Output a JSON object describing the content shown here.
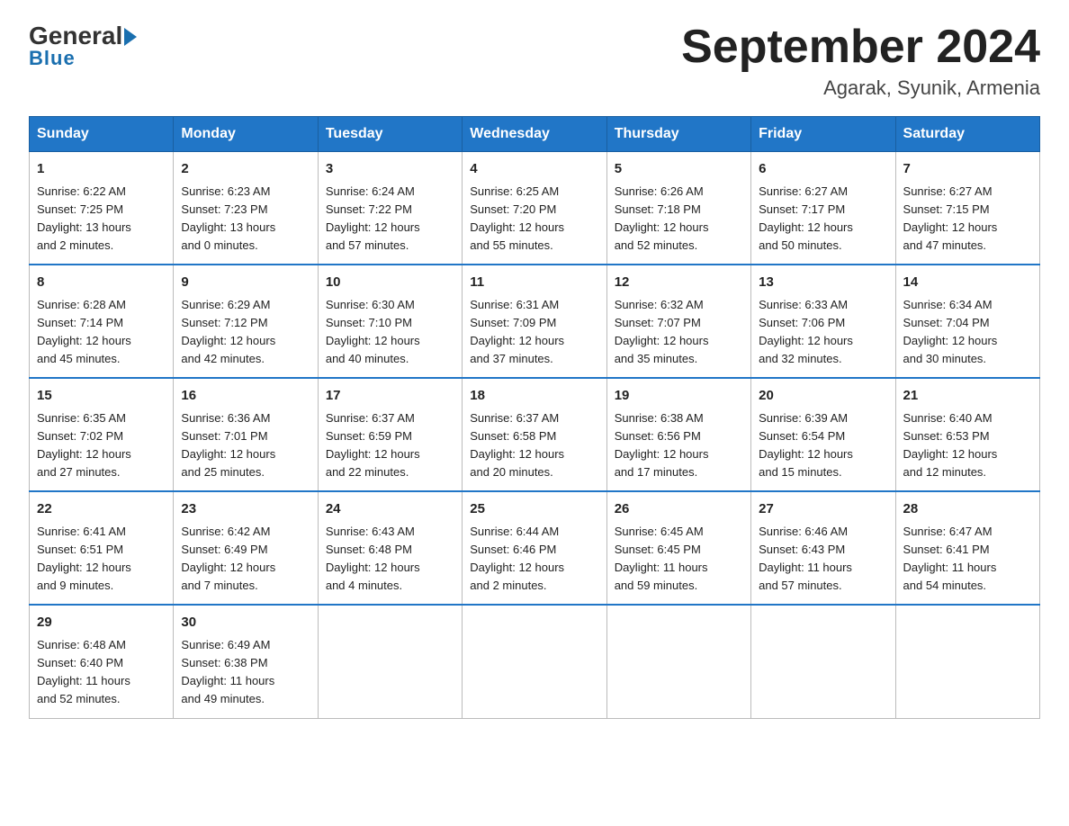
{
  "logo": {
    "general": "General",
    "blue": "Blue",
    "sub": "Blue"
  },
  "header": {
    "title": "September 2024",
    "location": "Agarak, Syunik, Armenia"
  },
  "days_header": [
    "Sunday",
    "Monday",
    "Tuesday",
    "Wednesday",
    "Thursday",
    "Friday",
    "Saturday"
  ],
  "weeks": [
    [
      {
        "day": "1",
        "sunrise": "6:22 AM",
        "sunset": "7:25 PM",
        "daylight": "13 hours and 2 minutes."
      },
      {
        "day": "2",
        "sunrise": "6:23 AM",
        "sunset": "7:23 PM",
        "daylight": "13 hours and 0 minutes."
      },
      {
        "day": "3",
        "sunrise": "6:24 AM",
        "sunset": "7:22 PM",
        "daylight": "12 hours and 57 minutes."
      },
      {
        "day": "4",
        "sunrise": "6:25 AM",
        "sunset": "7:20 PM",
        "daylight": "12 hours and 55 minutes."
      },
      {
        "day": "5",
        "sunrise": "6:26 AM",
        "sunset": "7:18 PM",
        "daylight": "12 hours and 52 minutes."
      },
      {
        "day": "6",
        "sunrise": "6:27 AM",
        "sunset": "7:17 PM",
        "daylight": "12 hours and 50 minutes."
      },
      {
        "day": "7",
        "sunrise": "6:27 AM",
        "sunset": "7:15 PM",
        "daylight": "12 hours and 47 minutes."
      }
    ],
    [
      {
        "day": "8",
        "sunrise": "6:28 AM",
        "sunset": "7:14 PM",
        "daylight": "12 hours and 45 minutes."
      },
      {
        "day": "9",
        "sunrise": "6:29 AM",
        "sunset": "7:12 PM",
        "daylight": "12 hours and 42 minutes."
      },
      {
        "day": "10",
        "sunrise": "6:30 AM",
        "sunset": "7:10 PM",
        "daylight": "12 hours and 40 minutes."
      },
      {
        "day": "11",
        "sunrise": "6:31 AM",
        "sunset": "7:09 PM",
        "daylight": "12 hours and 37 minutes."
      },
      {
        "day": "12",
        "sunrise": "6:32 AM",
        "sunset": "7:07 PM",
        "daylight": "12 hours and 35 minutes."
      },
      {
        "day": "13",
        "sunrise": "6:33 AM",
        "sunset": "7:06 PM",
        "daylight": "12 hours and 32 minutes."
      },
      {
        "day": "14",
        "sunrise": "6:34 AM",
        "sunset": "7:04 PM",
        "daylight": "12 hours and 30 minutes."
      }
    ],
    [
      {
        "day": "15",
        "sunrise": "6:35 AM",
        "sunset": "7:02 PM",
        "daylight": "12 hours and 27 minutes."
      },
      {
        "day": "16",
        "sunrise": "6:36 AM",
        "sunset": "7:01 PM",
        "daylight": "12 hours and 25 minutes."
      },
      {
        "day": "17",
        "sunrise": "6:37 AM",
        "sunset": "6:59 PM",
        "daylight": "12 hours and 22 minutes."
      },
      {
        "day": "18",
        "sunrise": "6:37 AM",
        "sunset": "6:58 PM",
        "daylight": "12 hours and 20 minutes."
      },
      {
        "day": "19",
        "sunrise": "6:38 AM",
        "sunset": "6:56 PM",
        "daylight": "12 hours and 17 minutes."
      },
      {
        "day": "20",
        "sunrise": "6:39 AM",
        "sunset": "6:54 PM",
        "daylight": "12 hours and 15 minutes."
      },
      {
        "day": "21",
        "sunrise": "6:40 AM",
        "sunset": "6:53 PM",
        "daylight": "12 hours and 12 minutes."
      }
    ],
    [
      {
        "day": "22",
        "sunrise": "6:41 AM",
        "sunset": "6:51 PM",
        "daylight": "12 hours and 9 minutes."
      },
      {
        "day": "23",
        "sunrise": "6:42 AM",
        "sunset": "6:49 PM",
        "daylight": "12 hours and 7 minutes."
      },
      {
        "day": "24",
        "sunrise": "6:43 AM",
        "sunset": "6:48 PM",
        "daylight": "12 hours and 4 minutes."
      },
      {
        "day": "25",
        "sunrise": "6:44 AM",
        "sunset": "6:46 PM",
        "daylight": "12 hours and 2 minutes."
      },
      {
        "day": "26",
        "sunrise": "6:45 AM",
        "sunset": "6:45 PM",
        "daylight": "11 hours and 59 minutes."
      },
      {
        "day": "27",
        "sunrise": "6:46 AM",
        "sunset": "6:43 PM",
        "daylight": "11 hours and 57 minutes."
      },
      {
        "day": "28",
        "sunrise": "6:47 AM",
        "sunset": "6:41 PM",
        "daylight": "11 hours and 54 minutes."
      }
    ],
    [
      {
        "day": "29",
        "sunrise": "6:48 AM",
        "sunset": "6:40 PM",
        "daylight": "11 hours and 52 minutes."
      },
      {
        "day": "30",
        "sunrise": "6:49 AM",
        "sunset": "6:38 PM",
        "daylight": "11 hours and 49 minutes."
      },
      null,
      null,
      null,
      null,
      null
    ]
  ],
  "labels": {
    "sunrise": "Sunrise:",
    "sunset": "Sunset:",
    "daylight": "Daylight:"
  }
}
